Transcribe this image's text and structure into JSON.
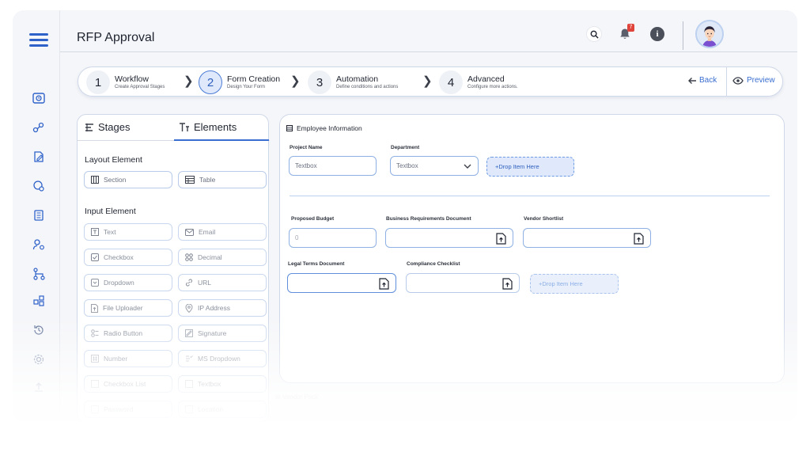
{
  "header": {
    "title": "RFP Approval",
    "notification_count": "7"
  },
  "stepper": {
    "steps": [
      {
        "num": "1",
        "title": "Workflow",
        "sub": "Create Approval Stages"
      },
      {
        "num": "2",
        "title": "Form Creation",
        "sub": "Design Your Form"
      },
      {
        "num": "3",
        "title": "Automation",
        "sub": "Define conditions and actions"
      },
      {
        "num": "4",
        "title": "Advanced",
        "sub": "Configure more actions."
      }
    ],
    "back_label": "Back",
    "preview_label": "Preview"
  },
  "left_panel": {
    "tabs": [
      "Stages",
      "Elements"
    ],
    "layout_title": "Layout Element",
    "layout_items": [
      "Section",
      "Table"
    ],
    "input_title": "Input Element",
    "input_items": [
      "Text",
      "Email",
      "Checkbox",
      "Decimal",
      "Dropdown",
      "URL",
      "File Uploader",
      "IP Address",
      "Radio Button",
      "Signature",
      "Number",
      "MS Dropdown",
      "Checkbox List",
      "Textbox",
      "Password",
      "Location"
    ]
  },
  "form": {
    "section_title": "Employee Information",
    "project_name_label": "Project Name",
    "project_name_placeholder": "Textbox",
    "department_label": "Department",
    "department_placeholder": "Textbox",
    "drop_label": "+Drop Item Here",
    "budget_label": "Proposed Budget",
    "budget_value": "0",
    "brd_label": "Business Requirements Document",
    "vendor_label": "Vendor Shortlist",
    "legal_label": "Legal Terms Document",
    "compliance_label": "Compliance Checklist",
    "drop_label_2": "+Drop Item Here",
    "next_section": "Vendor Pack"
  },
  "colors": {
    "accent": "#3a6ed0",
    "badge": "#e0433a"
  }
}
